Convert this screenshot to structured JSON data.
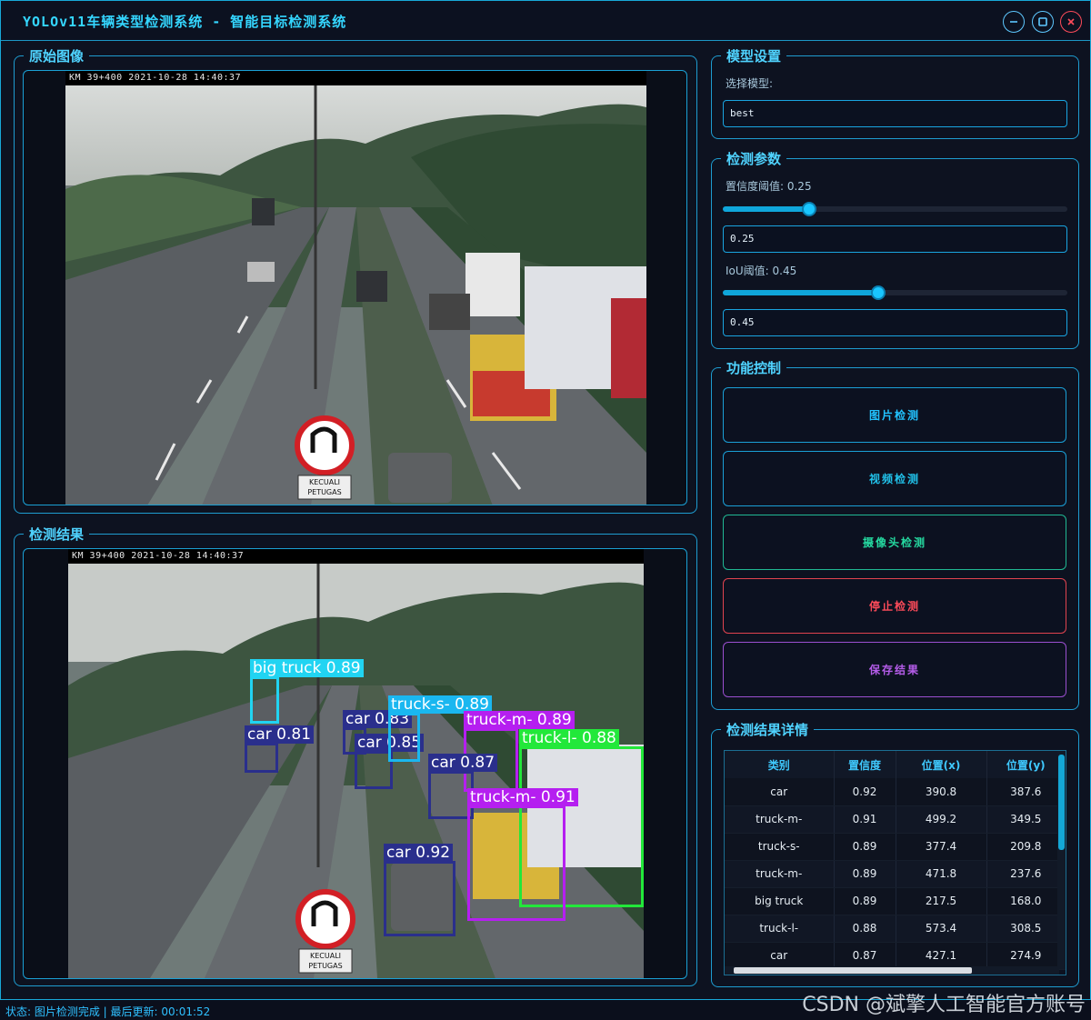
{
  "window": {
    "title": "YOLOv11车辆类型检测系统 - 智能目标检测系统",
    "controls": [
      "minimize-icon",
      "maximize-icon",
      "close-icon"
    ]
  },
  "original": {
    "group_title": "原始图像",
    "osd_text": "KM 39+400 2021-10-28 14:40:37",
    "sign_text": "KECUALI PETUGAS"
  },
  "result": {
    "group_title": "检测结果",
    "osd_text": "KM 39+400 2021-10-28 14:40:37",
    "detections": [
      {
        "label": "big truck 0.89",
        "color": "#21d4f2"
      },
      {
        "label": "car 0.81",
        "color": "#2a2f8c"
      },
      {
        "label": "car 0.83",
        "color": "#2a2f8c"
      },
      {
        "label": "car 0.85",
        "color": "#2a2f8c"
      },
      {
        "label": "truck-s- 0.89",
        "color": "#1ab7f0"
      },
      {
        "label": "truck-m- 0.89",
        "color": "#b51ff0"
      },
      {
        "label": "truck-l- 0.88",
        "color": "#22e83a"
      },
      {
        "label": "car 0.87",
        "color": "#2a2f8c"
      },
      {
        "label": "truck-m- 0.91",
        "color": "#b51ff0"
      },
      {
        "label": "car 0.92",
        "color": "#2a2f8c"
      }
    ]
  },
  "model_settings": {
    "group_title": "模型设置",
    "select_label": "选择模型:",
    "selected_model": "best"
  },
  "params": {
    "group_title": "检测参数",
    "conf_label": "置信度阈值: 0.25",
    "conf_value": "0.25",
    "conf_fraction": 0.25,
    "iou_label": "IoU阈值: 0.45",
    "iou_value": "0.45",
    "iou_fraction": 0.45
  },
  "controls": {
    "group_title": "功能控制",
    "buttons": [
      {
        "label": "图片检测",
        "color": "#22c3ff",
        "border": "#1a9fd6"
      },
      {
        "label": "视频检测",
        "color": "#21c2ea",
        "border": "#1a9fd6"
      },
      {
        "label": "摄像头检测",
        "color": "#25d9a0",
        "border": "#20b893"
      },
      {
        "label": "停止检测",
        "color": "#ff4b5a",
        "border": "#e0434f"
      },
      {
        "label": "保存结果",
        "color": "#b45ce8",
        "border": "#9b4fd0"
      }
    ]
  },
  "details": {
    "group_title": "检测结果详情",
    "columns": [
      "类别",
      "置信度",
      "位置(x)",
      "位置(y)"
    ],
    "rows": [
      [
        "car",
        "0.92",
        "390.8",
        "387.6"
      ],
      [
        "truck-m-",
        "0.91",
        "499.2",
        "349.5"
      ],
      [
        "truck-s-",
        "0.89",
        "377.4",
        "209.8"
      ],
      [
        "truck-m-",
        "0.89",
        "471.8",
        "237.6"
      ],
      [
        "big truck",
        "0.89",
        "217.5",
        "168.0"
      ],
      [
        "truck-l-",
        "0.88",
        "573.4",
        "308.5"
      ],
      [
        "car",
        "0.87",
        "427.1",
        "274.9"
      ]
    ]
  },
  "status": {
    "text": "状态: 图片检测完成 | 最后更新: 00:01:52"
  },
  "watermark": "CSDN @斌擎人工智能官方账号"
}
